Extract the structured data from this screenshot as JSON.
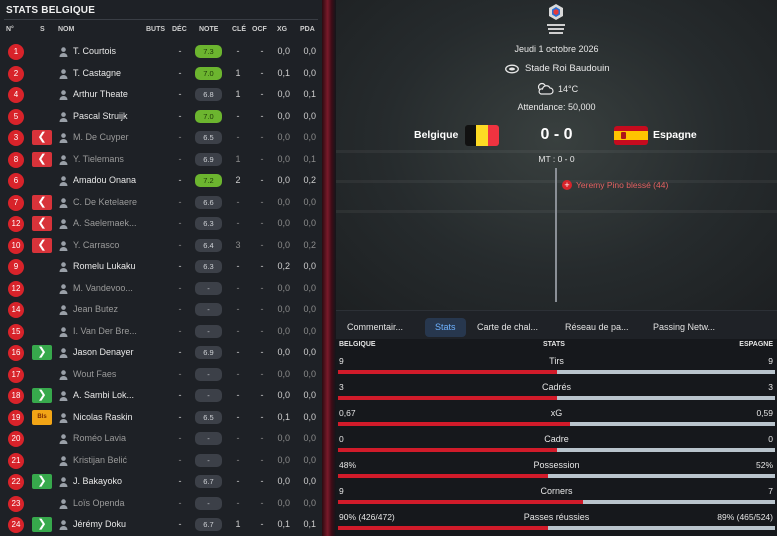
{
  "left_panel": {
    "title": "STATS BELGIQUE",
    "headers": {
      "num": "N°",
      "s": "S",
      "name": "NOM",
      "buts": "BUTS",
      "dec": "DÉC",
      "note": "NOTE",
      "cle": "CLÉ",
      "ocf": "OCF",
      "xg": "XG",
      "pda": "PDA"
    },
    "players": [
      {
        "num": "1",
        "sub": "",
        "name": "T. Courtois",
        "buts": "",
        "dec": "-",
        "note": "7.3",
        "good": true,
        "cle": "-",
        "ocf": "-",
        "xg": "0,0",
        "pda": "0,0",
        "dim": false
      },
      {
        "num": "2",
        "sub": "",
        "name": "T. Castagne",
        "buts": "",
        "dec": "-",
        "note": "7.0",
        "good": true,
        "cle": "1",
        "ocf": "-",
        "xg": "0,1",
        "pda": "0,0",
        "dim": false
      },
      {
        "num": "4",
        "sub": "",
        "name": "Arthur Theate",
        "buts": "",
        "dec": "-",
        "note": "6.8",
        "good": false,
        "cle": "1",
        "ocf": "-",
        "xg": "0,0",
        "pda": "0,1",
        "dim": false
      },
      {
        "num": "5",
        "sub": "",
        "name": "Pascal Struijk",
        "buts": "",
        "dec": "-",
        "note": "7.0",
        "good": true,
        "cle": "-",
        "ocf": "-",
        "xg": "0,0",
        "pda": "0,0",
        "dim": false
      },
      {
        "num": "3",
        "sub": "out",
        "name": "M. De Cuyper",
        "buts": "",
        "dec": "-",
        "note": "6.5",
        "good": false,
        "cle": "-",
        "ocf": "-",
        "xg": "0,0",
        "pda": "0,0",
        "dim": true
      },
      {
        "num": "8",
        "sub": "out",
        "name": "Y. Tielemans",
        "buts": "",
        "dec": "-",
        "note": "6.9",
        "good": false,
        "cle": "1",
        "ocf": "-",
        "xg": "0,0",
        "pda": "0,1",
        "dim": true
      },
      {
        "num": "6",
        "sub": "",
        "name": "Amadou Onana",
        "buts": "",
        "dec": "-",
        "note": "7.2",
        "good": true,
        "cle": "2",
        "ocf": "-",
        "xg": "0,0",
        "pda": "0,2",
        "dim": false
      },
      {
        "num": "7",
        "sub": "out",
        "name": "C. De Ketelaere",
        "buts": "",
        "dec": "-",
        "note": "6.6",
        "good": false,
        "cle": "-",
        "ocf": "-",
        "xg": "0,0",
        "pda": "0,0",
        "dim": true
      },
      {
        "num": "12",
        "sub": "out",
        "name": "A. Saelemaek...",
        "buts": "",
        "dec": "-",
        "note": "6.3",
        "good": false,
        "cle": "-",
        "ocf": "-",
        "xg": "0,0",
        "pda": "0,0",
        "dim": true
      },
      {
        "num": "10",
        "sub": "out",
        "name": "Y. Carrasco",
        "buts": "",
        "dec": "-",
        "note": "6.4",
        "good": false,
        "cle": "3",
        "ocf": "-",
        "xg": "0,0",
        "pda": "0,2",
        "dim": true
      },
      {
        "num": "9",
        "sub": "",
        "name": "Romelu Lukaku",
        "buts": "",
        "dec": "-",
        "note": "6.3",
        "good": false,
        "cle": "-",
        "ocf": "-",
        "xg": "0,2",
        "pda": "0,0",
        "dim": false
      },
      {
        "num": "12",
        "sub": "",
        "name": "M. Vandevoo...",
        "buts": "",
        "dec": "-",
        "note": "-",
        "good": false,
        "cle": "-",
        "ocf": "-",
        "xg": "0,0",
        "pda": "0,0",
        "dim": true
      },
      {
        "num": "14",
        "sub": "",
        "name": "Jean Butez",
        "buts": "",
        "dec": "-",
        "note": "-",
        "good": false,
        "cle": "-",
        "ocf": "-",
        "xg": "0,0",
        "pda": "0,0",
        "dim": true
      },
      {
        "num": "15",
        "sub": "",
        "name": "I. Van Der Bre...",
        "buts": "",
        "dec": "-",
        "note": "-",
        "good": false,
        "cle": "-",
        "ocf": "-",
        "xg": "0,0",
        "pda": "0,0",
        "dim": true
      },
      {
        "num": "16",
        "sub": "in",
        "name": "Jason Denayer",
        "buts": "",
        "dec": "-",
        "note": "6.9",
        "good": false,
        "cle": "-",
        "ocf": "-",
        "xg": "0,0",
        "pda": "0,0",
        "dim": false
      },
      {
        "num": "17",
        "sub": "",
        "name": "Wout Faes",
        "buts": "",
        "dec": "-",
        "note": "-",
        "good": false,
        "cle": "-",
        "ocf": "-",
        "xg": "0,0",
        "pda": "0,0",
        "dim": true
      },
      {
        "num": "18",
        "sub": "in",
        "name": "A. Sambi Lok...",
        "buts": "",
        "dec": "-",
        "note": "-",
        "good": false,
        "cle": "-",
        "ocf": "-",
        "xg": "0,0",
        "pda": "0,0",
        "dim": false
      },
      {
        "num": "19",
        "sub": "inj",
        "name": "Nicolas Raskin",
        "buts": "",
        "dec": "-",
        "note": "6.5",
        "good": false,
        "cle": "-",
        "ocf": "-",
        "xg": "0,1",
        "pda": "0,0",
        "dim": false
      },
      {
        "num": "20",
        "sub": "",
        "name": "Roméo Lavia",
        "buts": "",
        "dec": "-",
        "note": "-",
        "good": false,
        "cle": "-",
        "ocf": "-",
        "xg": "0,0",
        "pda": "0,0",
        "dim": true
      },
      {
        "num": "21",
        "sub": "",
        "name": "Kristijan Belić",
        "buts": "",
        "dec": "-",
        "note": "-",
        "good": false,
        "cle": "-",
        "ocf": "-",
        "xg": "0,0",
        "pda": "0,0",
        "dim": true
      },
      {
        "num": "22",
        "sub": "in",
        "name": "J. Bakayoko",
        "buts": "",
        "dec": "-",
        "note": "6.7",
        "good": false,
        "cle": "-",
        "ocf": "-",
        "xg": "0,0",
        "pda": "0,0",
        "dim": false
      },
      {
        "num": "23",
        "sub": "",
        "name": "Loïs Openda",
        "buts": "",
        "dec": "-",
        "note": "-",
        "good": false,
        "cle": "-",
        "ocf": "-",
        "xg": "0,0",
        "pda": "0,0",
        "dim": true
      },
      {
        "num": "24",
        "sub": "in",
        "name": "Jérémy Doku",
        "buts": "",
        "dec": "-",
        "note": "6.7",
        "good": false,
        "cle": "1",
        "ocf": "-",
        "xg": "0,1",
        "pda": "0,1",
        "dim": false
      }
    ],
    "injury_badge": "Bls"
  },
  "match": {
    "date": "Jeudi 1 octobre 2026",
    "stadium": "Stade Roi Baudouin",
    "temperature": "14°C",
    "attendance": "Attendance: 50,000",
    "home": "Belgique",
    "away": "Espagne",
    "score": "0 - 0",
    "halftime": "MT : 0 - 0",
    "event": "Yeremy Pino blessé (44)"
  },
  "tabs": [
    "Commentair...",
    "Stats",
    "Carte de chal...",
    "Réseau de pa...",
    "Passing Netw..."
  ],
  "stats": {
    "home_header": "BELGIQUE",
    "stats_header": "STATS",
    "away_header": "ESPAGNE",
    "rows": [
      {
        "label": "Tirs",
        "home": "9",
        "away": "9",
        "home_share": 0.5
      },
      {
        "label": "Cadrés",
        "home": "3",
        "away": "3",
        "home_share": 0.5
      },
      {
        "label": "xG",
        "home": "0,67",
        "away": "0,59",
        "home_share": 0.53
      },
      {
        "label": "Cadre",
        "home": "0",
        "away": "0",
        "home_share": 0.5
      },
      {
        "label": "Possession",
        "home": "48%",
        "away": "52%",
        "home_share": 0.48
      },
      {
        "label": "Corners",
        "home": "9",
        "away": "7",
        "home_share": 0.56
      },
      {
        "label": "Passes réussies",
        "home": "90% (426/472)",
        "away": "89% (465/524)",
        "home_share": 0.48
      }
    ]
  },
  "colors": {
    "accent_red": "#d8232a",
    "good_note": "#6cb52f",
    "sub_in": "#37a94c",
    "sub_out": "#d8333a",
    "injury": "#f2a516",
    "active_tab": "#6fb2ff"
  }
}
